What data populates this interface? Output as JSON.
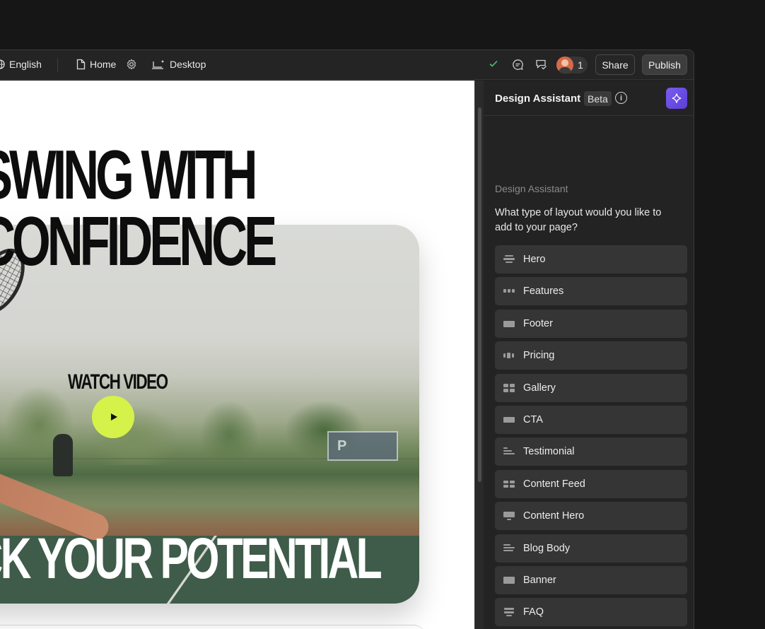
{
  "topbar": {
    "language": "English",
    "page": "Home",
    "viewport": "Desktop",
    "collaborators_count": "1",
    "share_label": "Share",
    "publish_label": "Publish",
    "icons": [
      "globe-icon",
      "page-icon",
      "gear-icon",
      "desktop-icon",
      "check-icon",
      "comment-icon",
      "review-icon"
    ],
    "check_color": "#4fbf7a"
  },
  "canvas": {
    "headline_line1": "SWING WITH",
    "headline_line2": "CONFIDENCE",
    "watch_video": "WATCH VIDEO",
    "sign_text": "P",
    "bottom_headline": "OCK YOUR POTENTIAL",
    "play_color": "#d4f24a"
  },
  "assistant": {
    "title": "Design Assistant",
    "badge": "Beta",
    "section_label": "Design Assistant",
    "question": "What type of layout would you like to add to your page?",
    "accent": "#6c4ee6",
    "options": [
      {
        "label": "Hero",
        "icon": "hero-layout-icon"
      },
      {
        "label": "Features",
        "icon": "features-layout-icon"
      },
      {
        "label": "Footer",
        "icon": "footer-layout-icon"
      },
      {
        "label": "Pricing",
        "icon": "pricing-layout-icon"
      },
      {
        "label": "Gallery",
        "icon": "gallery-layout-icon"
      },
      {
        "label": "CTA",
        "icon": "cta-layout-icon"
      },
      {
        "label": "Testimonial",
        "icon": "testimonial-layout-icon"
      },
      {
        "label": "Content Feed",
        "icon": "content-feed-layout-icon"
      },
      {
        "label": "Content Hero",
        "icon": "content-hero-layout-icon"
      },
      {
        "label": "Blog Body",
        "icon": "blog-body-layout-icon"
      },
      {
        "label": "Banner",
        "icon": "banner-layout-icon"
      },
      {
        "label": "FAQ",
        "icon": "faq-layout-icon"
      }
    ]
  }
}
